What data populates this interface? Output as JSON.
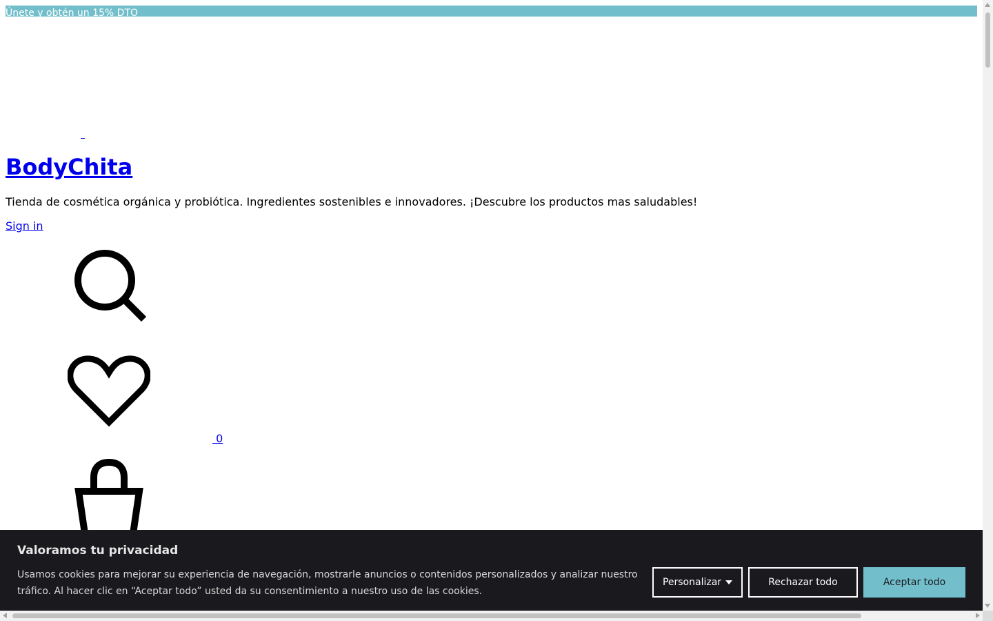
{
  "promo": {
    "link_text": "Únete y obtén un 15% DTO"
  },
  "header": {
    "site_title": "BodyChita",
    "tagline": "Tienda de cosmética orgánica y probiótica. Ingredientes sostenibles e innovadores. ¡Descubre los productos mas saludables!",
    "sign_in": "Sign in",
    "wishlist_count": " 0"
  },
  "icons": {
    "search": "search-icon",
    "wishlist": "heart-icon",
    "cart": "shopping-bag-icon"
  },
  "cookie_banner": {
    "title": "Valoramos tu privacidad",
    "text": "Usamos cookies para mejorar su experiencia de navegación, mostrarle anuncios o contenidos personalizados y analizar nuestro tráfico. Al hacer clic en “Aceptar todo” usted da su consentimiento a nuestro uso de las cookies.",
    "customize_label": "Personalizar",
    "reject_label": "Rechazar todo",
    "accept_label": "Aceptar todo"
  },
  "colors": {
    "accent": "#72bfcb",
    "banner_bg": "#1a1a1e",
    "link": "#0000ee"
  }
}
